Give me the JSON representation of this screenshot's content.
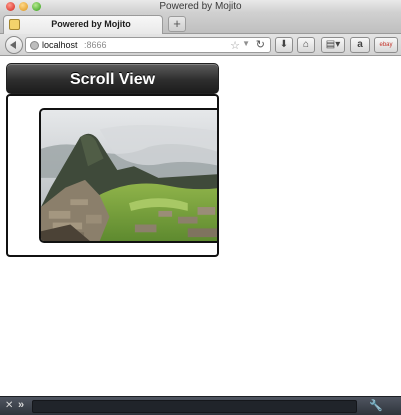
{
  "window": {
    "title": "Powered by Mojito"
  },
  "tabs": [
    {
      "label": "Powered by Mojito",
      "icon": "mojito-favicon-icon"
    }
  ],
  "tabstrip": {
    "new_tab_label": "+"
  },
  "navbar": {
    "url_host": "localhost",
    "url_port": ":8666",
    "star_glyph": "☆",
    "dropdown_glyph": "▼",
    "reload_glyph": "↻",
    "download_glyph": "⬇",
    "home_glyph": "⌂",
    "bookmarks_glyph": "▤▾",
    "amazon_label": "a",
    "ebay_label": "ebay"
  },
  "page": {
    "header_title": "Scroll View",
    "image_subject": "machu-picchu-photo"
  },
  "addon_bar": {
    "close_glyph": "✕",
    "chevron_glyph": "»",
    "wrench_glyph": "🔧"
  },
  "colors": {
    "header_gradient_top": "#5c5c5c",
    "header_gradient_bottom": "#1c1c1c",
    "addon_bar": "#2f343c"
  }
}
